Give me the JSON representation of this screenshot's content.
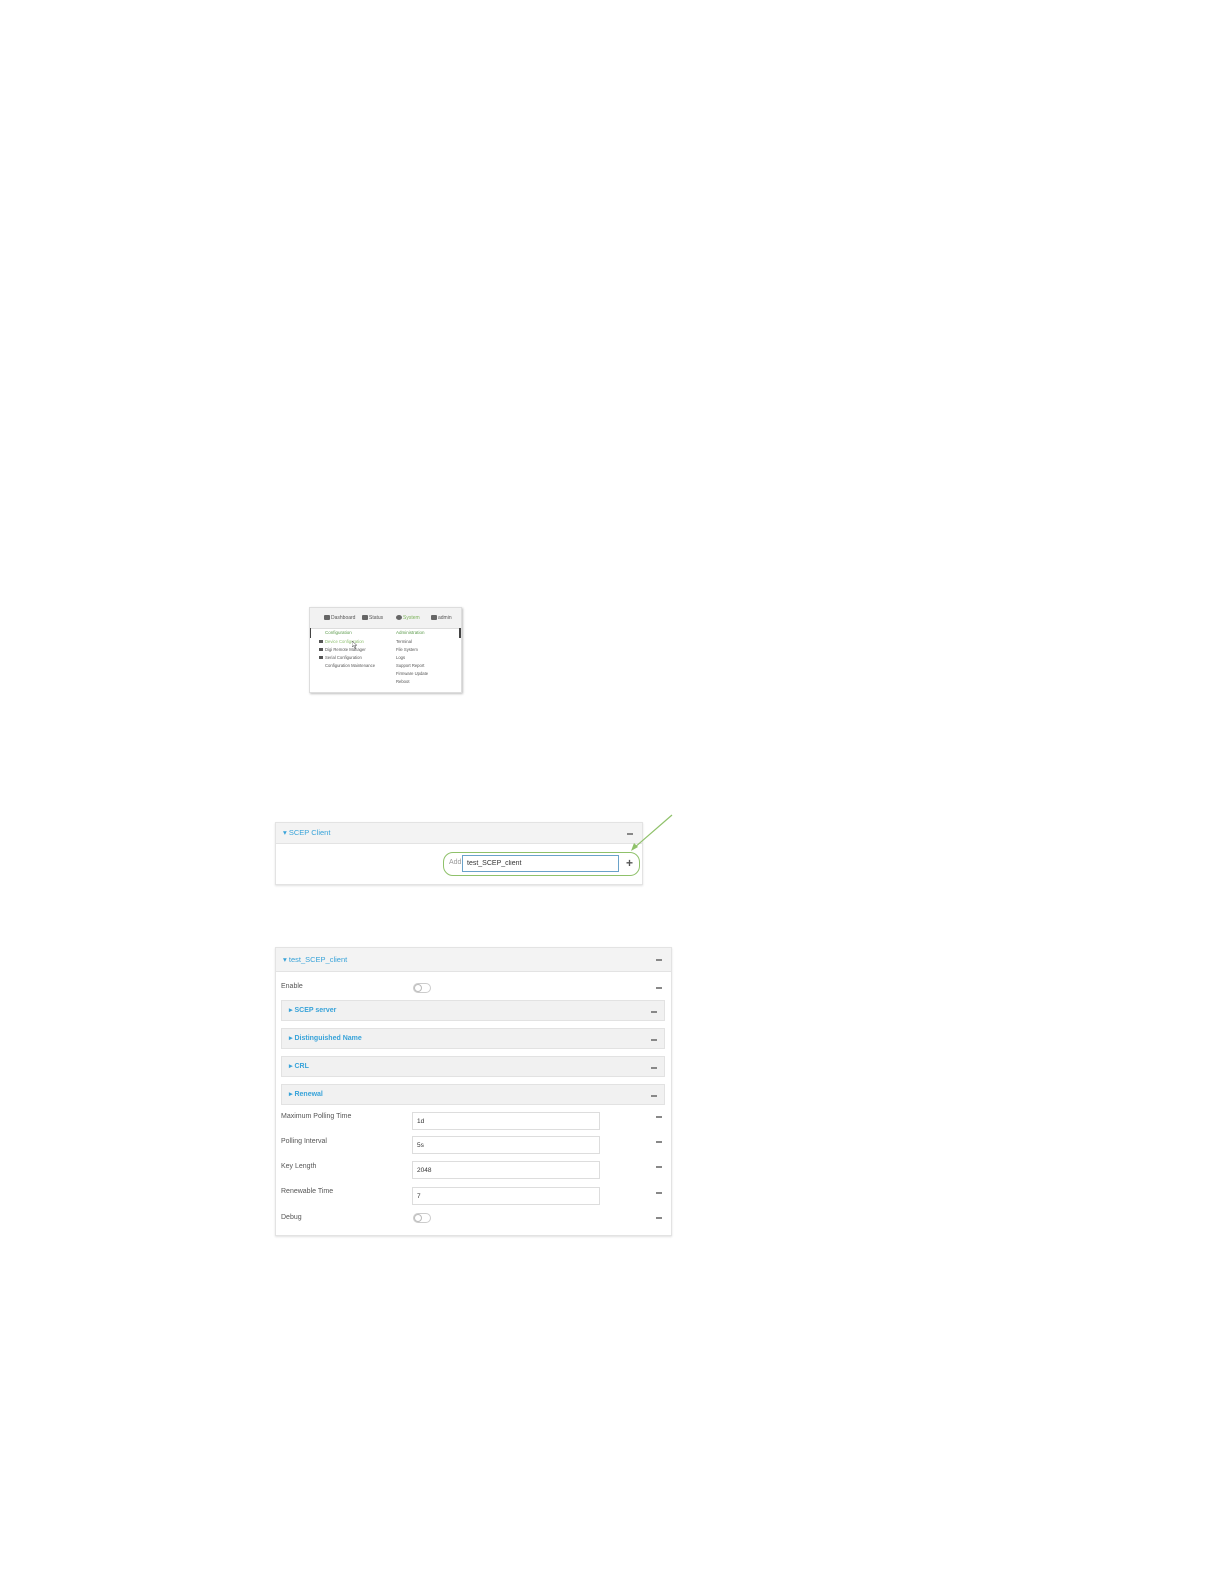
{
  "menu": {
    "nav": {
      "dashboard": "Dashboard",
      "status": "Status",
      "system": "System",
      "admin": "admin"
    },
    "configuration_heading": "Configuration",
    "configuration_items": [
      "Device Configuration",
      "Digi Remote Manager",
      "Serial Configuration",
      "Configuration Maintenance"
    ],
    "administration_heading": "Administration",
    "administration_items": [
      "Terminal",
      "File System",
      "Logs",
      "Support Report",
      "Firmware Update",
      "Reboot"
    ]
  },
  "scep_add": {
    "title": "SCEP Client",
    "add_label": "Add",
    "input_value": "test_SCEP_client",
    "plus": "+"
  },
  "client": {
    "title": "test_SCEP_client",
    "enable_label": "Enable",
    "enable_on": false,
    "sections": [
      "SCEP server",
      "Distinguished Name",
      "CRL",
      "Renewal"
    ],
    "fields": {
      "max_polling_time": {
        "label": "Maximum Polling Time",
        "value": "1d"
      },
      "polling_interval": {
        "label": "Polling Interval",
        "value": "5s"
      },
      "key_length": {
        "label": "Key Length",
        "value": "2048"
      },
      "renewable_time": {
        "label": "Renewable Time",
        "value": "7"
      }
    },
    "debug_label": "Debug",
    "debug_on": false
  },
  "colors": {
    "link_blue": "#38a3d9",
    "highlight_green": "#8fc16a",
    "panel_header": "#f3f3f3"
  }
}
